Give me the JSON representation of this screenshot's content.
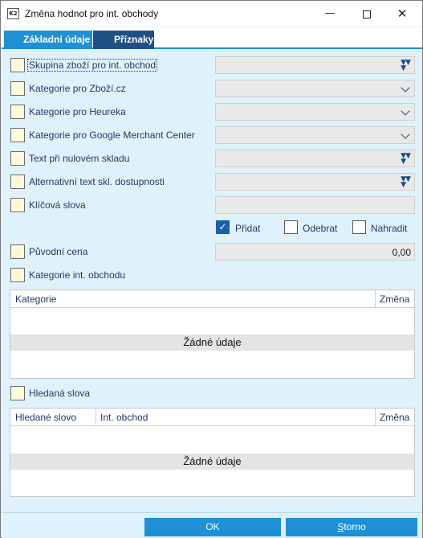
{
  "window": {
    "app_icon_text": "K2",
    "title": "Změna hodnot pro int. obchody",
    "minimize_icon": "minimize-icon",
    "maximize_icon": "maximize-icon",
    "close_icon": "close-icon"
  },
  "tabs": [
    {
      "label": "Základní údaje",
      "active": true
    },
    {
      "label": "Příznaky",
      "active": false
    }
  ],
  "fields": [
    {
      "label": "Skupina zboží pro int. obchod",
      "value": "",
      "control": "multi-select",
      "checked": false
    },
    {
      "label": "Kategorie pro Zboží.cz",
      "value": "",
      "control": "dropdown",
      "checked": false
    },
    {
      "label": "Kategorie pro Heureka",
      "value": "",
      "control": "dropdown",
      "checked": false
    },
    {
      "label": "Kategorie pro Google Merchant Center",
      "value": "",
      "control": "dropdown",
      "checked": false
    },
    {
      "label": "Text při nulovém skladu",
      "value": "",
      "control": "multi-select",
      "checked": false
    },
    {
      "label": "Alternativní text skl. dostupnosti",
      "value": "",
      "control": "multi-select",
      "checked": false
    },
    {
      "label": "Klíčová slova",
      "value": "",
      "control": "text",
      "checked": false
    }
  ],
  "keyword_mode": {
    "options": [
      {
        "label": "Přidat",
        "checked": true
      },
      {
        "label": "Odebrat",
        "checked": false
      },
      {
        "label": "Nahradit",
        "checked": false
      }
    ]
  },
  "original_price": {
    "label": "Původní cena",
    "value": "0,00",
    "checked": false
  },
  "categories_section": {
    "label": "Kategorie int. obchodu",
    "checked": false,
    "columns": [
      "Kategorie",
      "Změna"
    ],
    "empty_text": "Žádné údaje"
  },
  "search_words_section": {
    "label": "Hledaná slova",
    "checked": false,
    "columns": [
      "Hledané slovo",
      "Int. obchod",
      "Změna"
    ],
    "empty_text": "Žádné údaje"
  },
  "footer": {
    "ok_label": "OK",
    "cancel_label_underlined": "S",
    "cancel_label_rest": "torno"
  },
  "colors": {
    "accent": "#1f8fd6",
    "tab_inactive": "#1e4f86",
    "panel": "#dff2fb",
    "checkbox_fill": "#fff8db",
    "label_text": "#1f3a66"
  }
}
